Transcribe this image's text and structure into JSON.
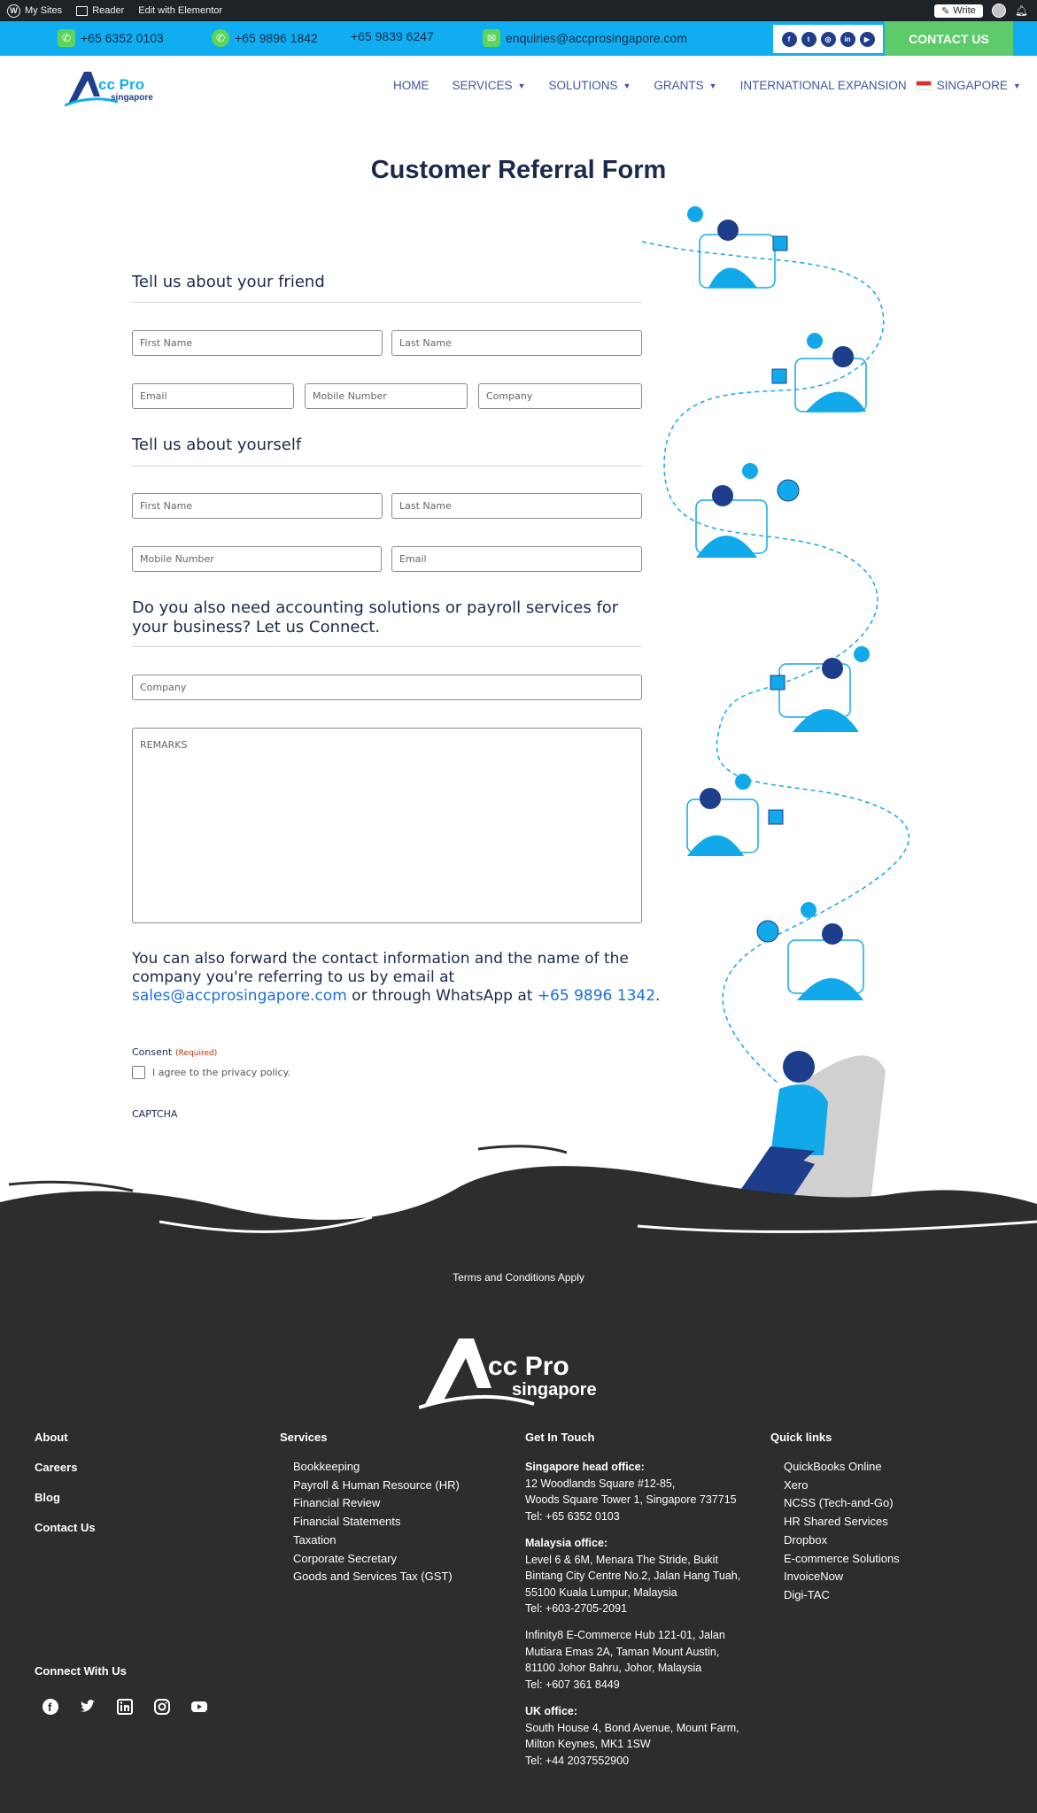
{
  "adminbar": {
    "my_sites": "My Sites",
    "reader": "Reader",
    "edit": "Edit with Elementor",
    "write": "Write"
  },
  "topbar": {
    "phone1": "+65 6352 0103",
    "whatsapp": "+65 9896 1842",
    "phone2": "+65 9839 6247",
    "email": "enquiries@accprosingapore.com",
    "contact_button": "CONTACT US"
  },
  "logo": {
    "text_main": "cc Pro",
    "text_sub": "singapore"
  },
  "menu": {
    "home": "HOME",
    "services": "SERVICES",
    "solutions": "SOLUTIONS",
    "grants": "GRANTS",
    "international": "INTERNATIONAL EXPANSION",
    "singapore": "SINGAPORE"
  },
  "page": {
    "title": "Customer Referral Form"
  },
  "form": {
    "friend_title": "Tell us about your friend",
    "friend_first": "First Name",
    "friend_last": "Last Name",
    "friend_email": "Email",
    "friend_mobile": "Mobile Number",
    "friend_company": "Company",
    "self_title": "Tell us about yourself",
    "self_first": "First Name",
    "self_last": "Last Name",
    "self_mobile": "Mobile Number",
    "self_email": "Email",
    "connect_title": "Do you also need accounting solutions or payroll services for your business? Let us Connect.",
    "company": "Company",
    "remarks": "REMARKS",
    "forward_text_1": "You can also forward the contact information and the name of the company you're referring to us by email at ",
    "forward_email": "sales@accprosingapore.com",
    "forward_text_2": " or through WhatsApp at ",
    "forward_phone": "+65 9896 1342",
    "forward_text_3": ".",
    "consent": "Consent",
    "required": "(Required)",
    "agree": "I agree to the privacy policy.",
    "captcha": "CAPTCHA"
  },
  "footer": {
    "terms": "Terms and Conditions Apply",
    "col1": [
      "About",
      "Careers",
      "Blog",
      "Contact Us"
    ],
    "services_title": "Services",
    "services": [
      "Bookkeeping",
      "Payroll & Human Resource (HR)",
      "Financial Review",
      "Financial Statements",
      "Taxation",
      "Corporate Secretary",
      "Goods and Services Tax (GST)"
    ],
    "touch_title": "Get In Touch",
    "sg_title": "Singapore head office:",
    "sg_lines": [
      "12 Woodlands Square #12-85,",
      "Woods Square Tower 1, Singapore 737715",
      "Tel: +65 6352 0103"
    ],
    "my_title": "Malaysia office:",
    "my_lines": [
      "Level 6 & 6M, Menara The Stride, Bukit",
      "Bintang City Centre No.2, Jalan Hang Tuah,",
      "55100 Kuala Lumpur, Malaysia",
      "Tel: +603-2705-2091"
    ],
    "jb_lines": [
      "Infinity8 E-Commerce Hub 121-01, Jalan",
      "Mutiara Emas 2A, Taman Mount Austin,",
      "81100 Johor Bahru, Johor, Malaysia",
      "Tel: +607 361 8449"
    ],
    "uk_title": "UK office:",
    "uk_lines": [
      "South House 4, Bond Avenue, Mount Farm,",
      "Milton Keynes, MK1 1SW",
      "Tel: +44 2037552900"
    ],
    "quick_title": "Quick links",
    "quick": [
      "QuickBooks Online",
      "Xero",
      "NCSS (Tech-and-Go)",
      "HR Shared Services",
      "Dropbox",
      "E-commerce Solutions",
      "InvoiceNow",
      "Digi-TAC"
    ],
    "connect_title": "Connect With Us",
    "social_icons": [
      "facebook-icon",
      "twitter-icon",
      "linkedin-icon",
      "instagram-icon",
      "youtube-icon"
    ]
  },
  "colors": {
    "topbar": "#10aef0",
    "contact_button": "#5ecb6b",
    "footer_bg": "#2d2d2d",
    "link": "#1a6fd9",
    "accent_blue": "#12a9ea"
  }
}
